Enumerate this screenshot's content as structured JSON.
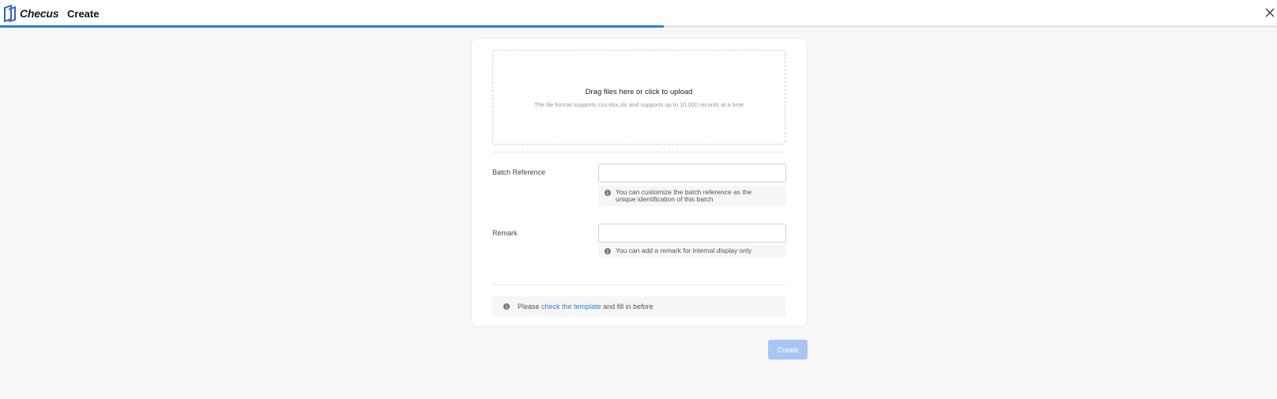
{
  "header": {
    "brand_name": "Checus",
    "title": "Create",
    "close_icon": "close-icon",
    "progress_percent": 52
  },
  "upload": {
    "title": "Drag files here or click to upload",
    "hint": "The file format supports csv,xlsx,xls and supports up to 10,000 records at a time"
  },
  "form": {
    "batch_reference": {
      "label": "Batch Reference",
      "value": "",
      "placeholder": "",
      "help_line1": "You can customize the batch reference as the",
      "help_line2": "unique identification of this batch"
    },
    "remark": {
      "label": "Remark",
      "value": "",
      "placeholder": "",
      "help": "You can add a remark for internal display only"
    }
  },
  "note": {
    "prefix": "Please",
    "link_text": "check the template",
    "suffix": "and fill in before"
  },
  "actions": {
    "create_label": "Create"
  },
  "colors": {
    "accent": "#2f7de1",
    "button_disabled": "#a7c6f5",
    "background": "#f7f7f7"
  }
}
